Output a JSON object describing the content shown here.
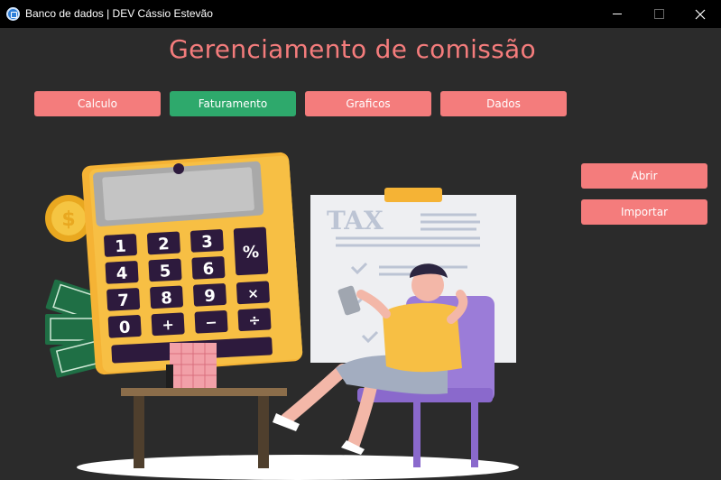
{
  "window": {
    "title": "Banco de dados | DEV Cássio Estevão"
  },
  "page": {
    "heading": "Gerenciamento de comissão"
  },
  "nav": {
    "buttons": [
      {
        "label": "Calculo",
        "active": false
      },
      {
        "label": "Faturamento",
        "active": true
      },
      {
        "label": "Graficos",
        "active": false
      },
      {
        "label": "Dados",
        "active": false
      }
    ]
  },
  "side": {
    "open_label": "Abrir",
    "import_label": "Importar"
  },
  "illustration": {
    "document_text": "TAX",
    "keys": [
      "1",
      "2",
      "3",
      "%",
      "4",
      "5",
      "6",
      "7",
      "8",
      "9",
      "×",
      "0",
      "+",
      "−",
      "÷"
    ]
  },
  "colors": {
    "background": "#2b2b2b",
    "accent": "#f47c7c",
    "active": "#2ea96c",
    "titlebar": "#000000"
  }
}
